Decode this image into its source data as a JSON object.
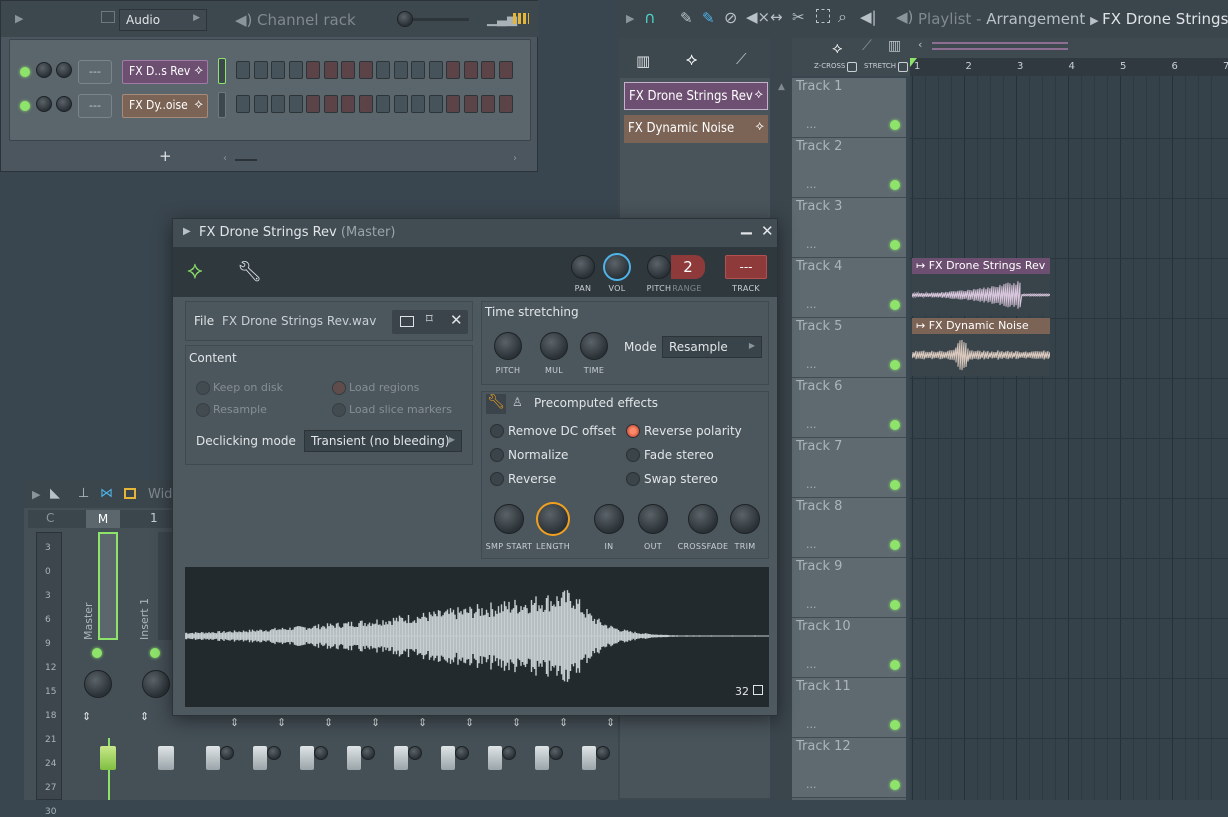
{
  "channel_rack": {
    "selector": "Audio",
    "title": "Channel rack",
    "channels": [
      {
        "mixer": "---",
        "name": "FX D..s Rev",
        "color": "#6d4f72"
      },
      {
        "mixer": "---",
        "name": "FX Dy..oise",
        "color": "#7b6355"
      }
    ],
    "add_label": "+"
  },
  "playlist": {
    "title": "Playlist",
    "crumb1": "Arrangement",
    "crumb2": "FX Drone Strings Rev",
    "zcross": "Z-CROSS",
    "stretch": "STRETCH",
    "ruler": [
      "1",
      "2",
      "3",
      "4",
      "5",
      "6",
      "7"
    ],
    "clips": [
      {
        "name": "FX Drone Strings Rev",
        "color": "#6d4f72"
      },
      {
        "name": "FX Dynamic Noise",
        "color": "#7b6355"
      }
    ],
    "tracks": [
      "Track 1",
      "Track 2",
      "Track 3",
      "Track 4",
      "Track 5",
      "Track 6",
      "Track 7",
      "Track 8",
      "Track 9",
      "Track 10",
      "Track 11",
      "Track 12"
    ],
    "track_dots": "...",
    "arranged": [
      {
        "name": "FX Drone Strings Rev",
        "track": 4
      },
      {
        "name": "FX Dynamic Noise",
        "track": 5
      }
    ]
  },
  "mixer": {
    "label": "Wid",
    "cols": [
      "C",
      "M",
      "1"
    ],
    "strips": [
      "Master",
      "Insert 1"
    ],
    "scale": [
      "3",
      "0",
      "3",
      "6",
      "9",
      "12",
      "15",
      "18",
      "21",
      "24",
      "27",
      "30"
    ]
  },
  "sampler": {
    "title": "FX Drone Strings Rev",
    "subtitle": "(Master)",
    "top_knobs": {
      "pan": "PAN",
      "vol": "VOL",
      "pitch": "PITCH",
      "range": "RANGE",
      "track": "TRACK"
    },
    "range_value": "2",
    "track_value": "---",
    "file_label": "File",
    "file_name": "FX Drone Strings Rev.wav",
    "content_label": "Content",
    "content_options": [
      "Keep on disk",
      "Load regions",
      "Resample",
      "Load slice markers"
    ],
    "declick_label": "Declicking mode",
    "declick_value": "Transient (no bleeding)",
    "ts_label": "Time stretching",
    "ts_knobs": [
      "PITCH",
      "MUL",
      "TIME"
    ],
    "mode_label": "Mode",
    "mode_value": "Resample",
    "precomp_label": "Precomputed effects",
    "effects_left": [
      {
        "label": "Remove DC offset",
        "on": false
      },
      {
        "label": "Normalize",
        "on": false
      },
      {
        "label": "Reverse",
        "on": false
      }
    ],
    "effects_right": [
      {
        "label": "Reverse polarity",
        "on": true
      },
      {
        "label": "Fade stereo",
        "on": false
      },
      {
        "label": "Swap stereo",
        "on": false
      }
    ],
    "fx_knobs": [
      "SMP START",
      "LENGTH",
      "IN",
      "OUT",
      "CROSSFADE",
      "TRIM"
    ],
    "wave_label": "32"
  },
  "colors": {
    "accent_green": "#8ee36a",
    "knob_active": "#4fb3e8",
    "length_knob": "#f0a020",
    "reverse_polarity": "#ff7a5c"
  }
}
